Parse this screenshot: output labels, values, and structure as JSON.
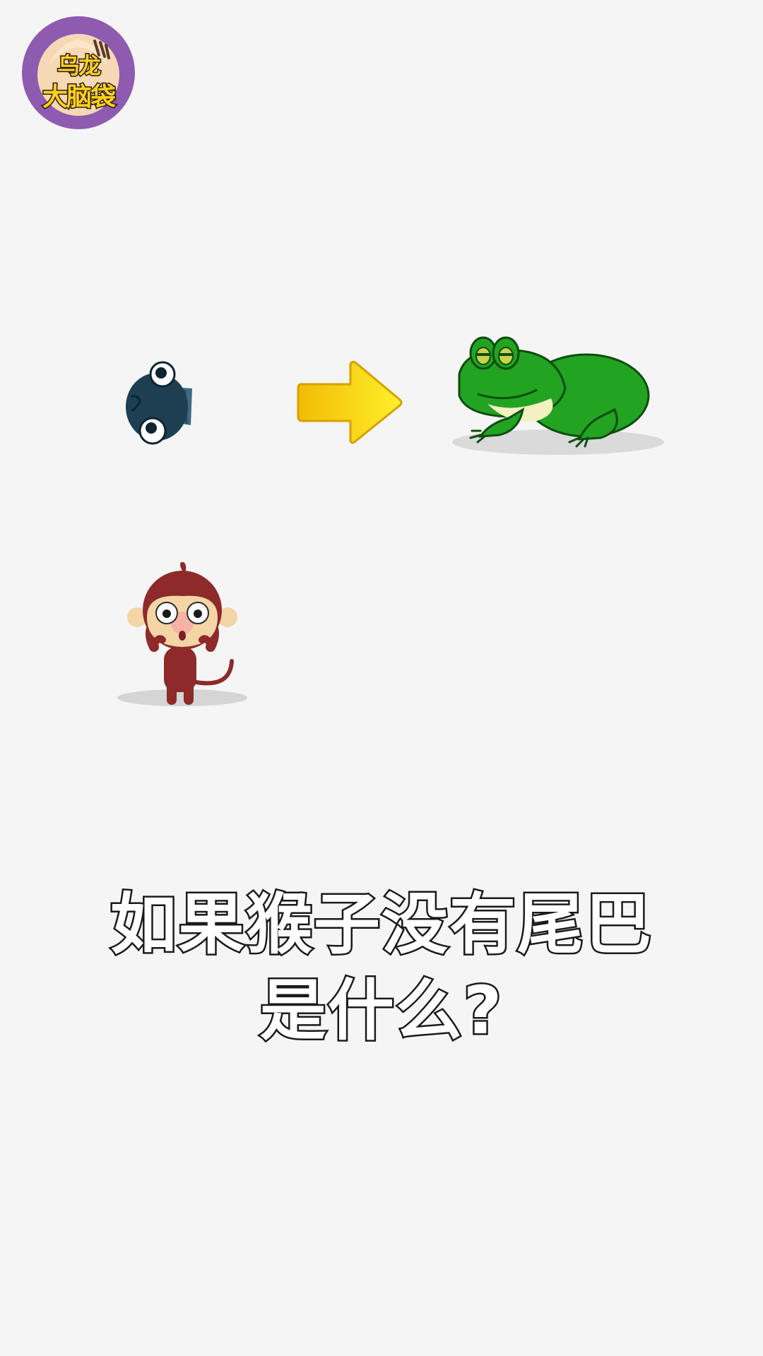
{
  "logo": {
    "line1": "乌龙",
    "line2": "大脑袋",
    "badge_color": "#8e5bb0"
  },
  "scene": {
    "left_item": "tadpole-icon",
    "connector": "arrow-right-icon",
    "right_item": "frog-icon",
    "subject": "monkey-icon"
  },
  "question": {
    "line1": "如果猴子没有尾巴",
    "line2": "是什么?"
  }
}
